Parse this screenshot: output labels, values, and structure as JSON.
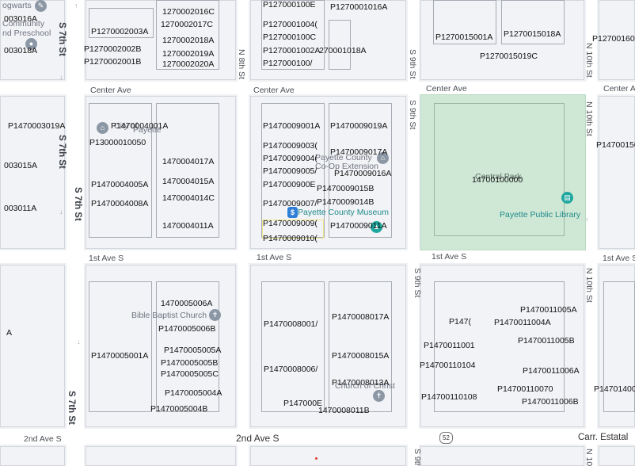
{
  "streets": {
    "s7th_top": "S 7th St",
    "s7th_mid": "S 7th St",
    "s7th_bottom": "S 7th St",
    "s7th_left": "S 7th St",
    "n8th": "N 8th St",
    "s9th_top": "S 9th St",
    "s9th_mid": "S 9th St",
    "s9th_lower": "S 9th St",
    "s9th_bottom": "S 9th",
    "n10th_top": "N 10th St",
    "n10th_mid": "N 10th St",
    "n10th_lower": "N 10th St",
    "n10th_bottom": "N 10th",
    "center_ave_1": "Center Ave",
    "center_ave_2": "Center Ave",
    "center_ave_3": "Center Ave",
    "center_ave_4": "Center Ave",
    "first_ave_1": "1st Ave S",
    "first_ave_2": "1st Ave S",
    "first_ave_3": "1st Ave S",
    "first_ave_4": "1st Ave S",
    "second_ave_1": "2nd Ave S",
    "second_ave_2": "2nd Ave S",
    "carr": "Carr. Estatal",
    "route_shield": "52"
  },
  "pois": {
    "hogwarts_1": "ogwarts",
    "hogwarts_2": "Community",
    "hogwarts_3": "nd Preschool",
    "city_payette_1": "City of",
    "city_payette_2": "Payette",
    "coop_1": "Payette County",
    "coop_2": "Co-Op Extension",
    "museum": "Payette County Museum",
    "central_park": "Central Park",
    "library": "Payette Public Library",
    "bible_church": "Bible Baptist Church",
    "church_christ": "Church of Christ"
  },
  "marker_label": "$",
  "parcels": [
    "003016A",
    "003018A",
    "1270002016C",
    "1270002017C",
    "P1270002003A",
    "1270002018A",
    "P1270002002B",
    "1270002019A",
    "P1270002001B",
    "1270002020A",
    "P127000100E",
    "P1270001016A",
    "P1270001004(",
    "P127000100C",
    "P1270001002A",
    "270001018A",
    "P127000100/",
    "P1270015001A",
    "P1270015018A",
    "P1270015019C",
    "P12700160",
    "P1470003019A",
    "P1470004001A",
    "P13000010050",
    "003015A",
    "1470004017A",
    "P1470004005A",
    "1470004015A",
    "1470004014C",
    "003011A",
    "P1470004008A",
    "1470004011A",
    "P1470009001A",
    "P1470009019A",
    "P1470009003(",
    "P1470009017A",
    "P1470009004(",
    "P1470009005/",
    "P1470009016A",
    "P147000900E",
    "P1470009015B",
    "P1470009007/",
    "P1470009014B",
    "P1470009009(",
    "P1470009011A",
    "P1470009010(",
    "14700100000",
    "P14700150",
    "1470005006A",
    "P1470005006B",
    "P1470005005A",
    "P1470005005B",
    "P1470005005C",
    "P1470005004A",
    "P1470005004B",
    "P1470005001A",
    "P1470008001/",
    "P1470008017A",
    "P1470008015A",
    "P1470008006/",
    "P1470008013A",
    "P147000E",
    "1470008011B",
    "P1470011005A",
    "P147(",
    "P1470011004A",
    "P1470011005B",
    "P1470011001",
    "P14700110104",
    "P1470011006A",
    "P14700110070",
    "P14700110108",
    "P1470011006B",
    "A",
    "P14701400"
  ]
}
